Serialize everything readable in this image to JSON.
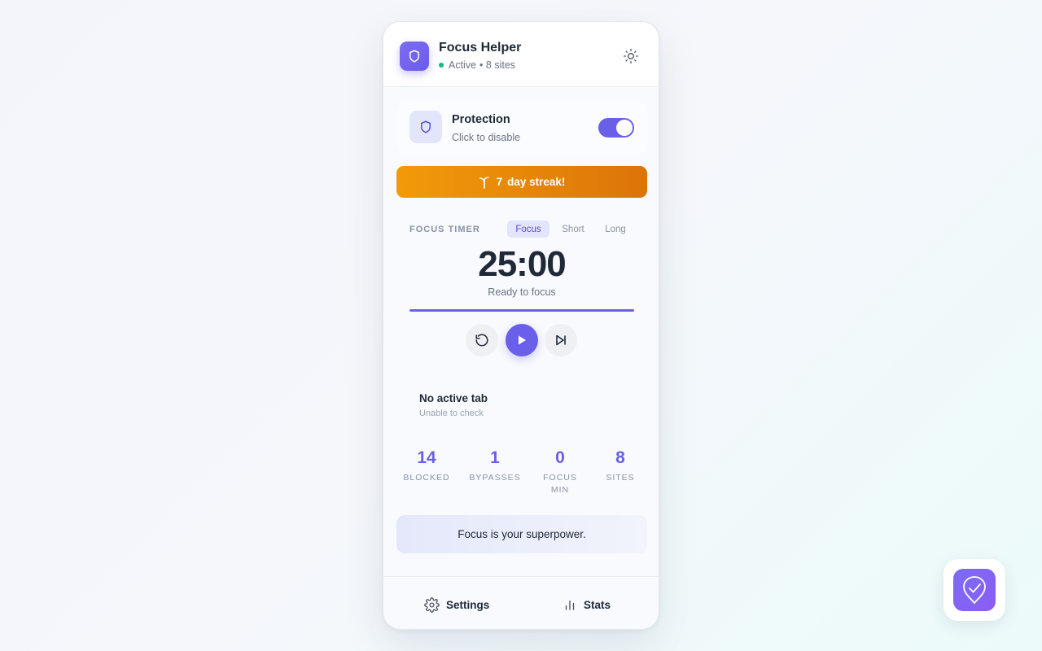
{
  "app": {
    "title": "Focus Helper",
    "status": "Active",
    "sites_text": "• 8 sites"
  },
  "protection": {
    "title": "Protection",
    "subtitle": "Click to disable",
    "enabled": true
  },
  "streak": {
    "count": "7",
    "label": "day streak!"
  },
  "timer": {
    "label": "FOCUS TIMER",
    "modes": [
      "Focus",
      "Short",
      "Long"
    ],
    "active_mode": "Focus",
    "time": "25:00",
    "status": "Ready to focus",
    "progress": 1.0
  },
  "active_tab": {
    "title": "No active tab",
    "subtitle": "Unable to check"
  },
  "stats": [
    {
      "value": "14",
      "label": "BLOCKED"
    },
    {
      "value": "1",
      "label": "BYPASSES"
    },
    {
      "value": "0",
      "label": "FOCUS MIN"
    },
    {
      "value": "8",
      "label": "SITES"
    }
  ],
  "quote": "Focus is your superpower.",
  "footer": {
    "settings_label": "Settings",
    "stats_label": "Stats"
  },
  "colors": {
    "accent": "#6a5fe8",
    "streak": "#f29a0a",
    "status_active": "#10b981"
  },
  "icons": [
    "shield-icon",
    "sun-icon",
    "sprout-icon",
    "reset-icon",
    "play-icon",
    "skip-icon",
    "gear-icon",
    "bar-chart-icon",
    "shield-check-icon"
  ]
}
